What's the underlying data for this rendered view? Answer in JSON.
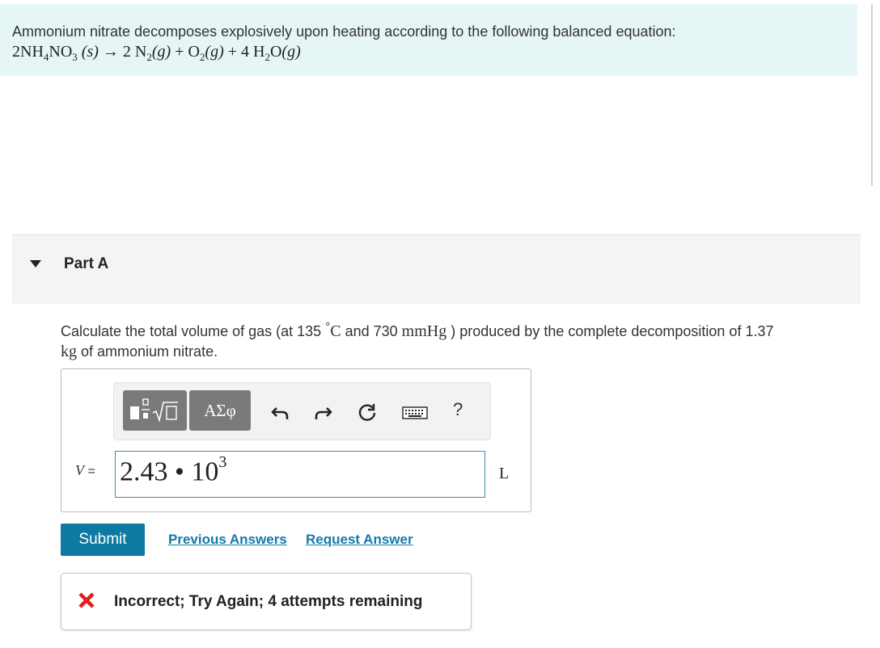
{
  "intro": {
    "text": "Ammonium nitrate decomposes explosively upon heating according to the following balanced equation:",
    "equation": {
      "coef_1": "2",
      "reactant_a": "NH",
      "reactant_a_sub": "4",
      "reactant_b": "NO",
      "reactant_b_sub": "3",
      "reactant_state": "(s)",
      "arrow": "→",
      "coef_2": "2",
      "p1": "N",
      "p1_sub": "2",
      "p1_state": "(g)",
      "plus_1": "+",
      "p2": "O",
      "p2_sub": "2",
      "p2_state": "(g)",
      "plus_2": "+",
      "coef_3": "4",
      "p3_a": "H",
      "p3_sub": "2",
      "p3_b": "O",
      "p3_state": "(g)"
    }
  },
  "part": {
    "label": "Part A",
    "toggle_icon": "caret-down-icon"
  },
  "question": {
    "text_1": "Calculate the total volume of gas (at 135",
    "degree": "°",
    "temp_unit": "C",
    "text_2": "and 730",
    "pressure_unit": "mmHg",
    "text_3": ") produced by the complete decomposition of 1.37",
    "mass_unit": "kg",
    "text_4": "of ammonium nitrate."
  },
  "toolbar": {
    "template_icon": "fraction-sqrt-template-icon",
    "greek_label": "ΑΣφ",
    "undo_icon": "undo-icon",
    "redo_icon": "redo-icon",
    "reset_icon": "reset-icon",
    "keyboard_icon": "keyboard-icon",
    "help_label": "?"
  },
  "answer": {
    "variable": "V",
    "equals": "=",
    "mantissa": "2.43",
    "times": "•",
    "base": "10",
    "exponent": "3",
    "unit": "L"
  },
  "actions": {
    "submit_label": "Submit",
    "previous_answers_label": "Previous Answers",
    "request_answer_label": "Request Answer"
  },
  "feedback": {
    "icon": "x-icon",
    "text": "Incorrect; Try Again; 4 attempts remaining",
    "color": "#e0201b"
  },
  "colors": {
    "intro_bg": "#e6f5f5",
    "submit_bg": "#0d7aa3",
    "link": "#1279ae",
    "input_border": "#3f8fa8"
  }
}
